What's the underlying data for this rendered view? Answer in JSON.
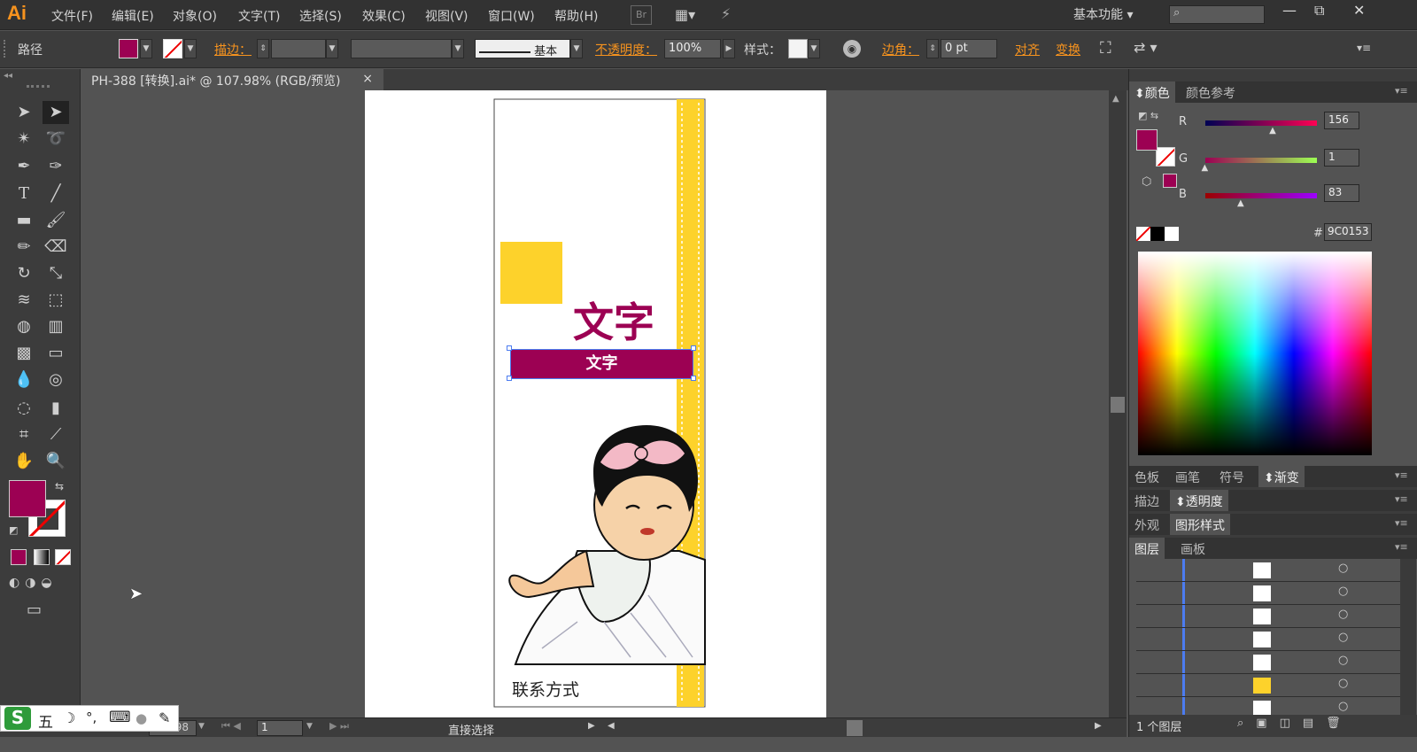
{
  "app": {
    "logo": "Ai",
    "workspace": "基本功能"
  },
  "menu": [
    "文件(F)",
    "编辑(E)",
    "对象(O)",
    "文字(T)",
    "选择(S)",
    "效果(C)",
    "视图(V)",
    "窗口(W)",
    "帮助(H)"
  ],
  "bridge_label": "Br",
  "window_controls": {
    "minimize": "—",
    "restore": "⧉",
    "close": "✕"
  },
  "control": {
    "object_type": "路径",
    "stroke_label": "描边：",
    "stroke_profile": "基本",
    "opacity_label": "不透明度：",
    "opacity_value": "100%",
    "style_label": "样式：",
    "corner_label": "边角：",
    "corner_value": "0 pt",
    "align_label": "对齐",
    "transform_label": "变换"
  },
  "document": {
    "tab_title": "PH-388 [转换].ai* @ 107.98% (RGB/预览)",
    "close_glyph": "×"
  },
  "artwork": {
    "big_title": "文字",
    "bar_text": "文字",
    "contact": "联系方式"
  },
  "colors": {
    "fill": "#9C0153",
    "yellow": "#FDD22B",
    "panel_bg": "#3c3c3c",
    "accent": "#f7931e"
  },
  "color_panel": {
    "tabs": [
      "颜色",
      "颜色参考"
    ],
    "r_label": "R",
    "g_label": "G",
    "b_label": "B",
    "r": 156,
    "g": 1,
    "b": 83,
    "r_text": "156",
    "g_text": "1",
    "b_text": "83",
    "hash": "#",
    "hex": "9C0153"
  },
  "panel_groups": {
    "group1": [
      "色板",
      "画笔",
      "符号",
      "渐变"
    ],
    "group2": [
      "描边",
      "透明度"
    ],
    "group3": [
      "外观",
      "图形样式"
    ],
    "group4": [
      "图层",
      "画板"
    ]
  },
  "layers_footer": "1 个图层",
  "status": {
    "zoom": "107.98",
    "page": "1",
    "tool": "直接选择"
  },
  "ime": {
    "brand": "S",
    "mode": "五",
    "moon": "☽",
    "punct": "°,",
    "keyboard": "⌨",
    "user": "●",
    "tools": "✎"
  }
}
